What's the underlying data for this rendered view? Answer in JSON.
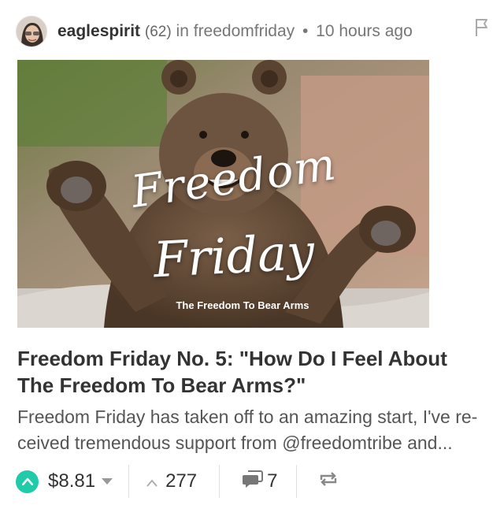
{
  "post": {
    "author": "eaglespirit",
    "reputation": "(62)",
    "in_label": "in",
    "community": "freedomfriday",
    "separator": "•",
    "time": "10 hours ago",
    "image": {
      "line1": "Freedom",
      "line2": "Friday",
      "caption": "The Freedom To Bear Arms"
    },
    "title": "Freedom Friday No. 5: \"How Do I Feel About The Freedom To Bear Arms?\"",
    "summary": "Freedom Friday has taken off to an amazing start, I've re-ceived tremendous support from @freedomtribe and..."
  },
  "actions": {
    "payout": "$8.81",
    "votes": "277",
    "comments": "7"
  },
  "icons": {
    "flag": "flag-icon",
    "upvote": "upvote-icon",
    "votes": "chevron-up-icon",
    "comments": "comment-icon",
    "resteem": "resteem-icon"
  },
  "colors": {
    "upvote_accent": "#1fcba8",
    "author_text": "#333333",
    "meta_text": "#777777"
  }
}
